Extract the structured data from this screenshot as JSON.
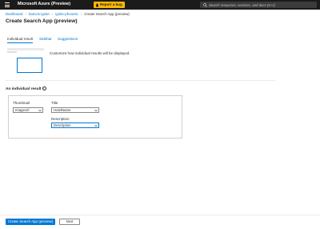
{
  "header": {
    "brand": "Microsoft Azure (Preview)",
    "report_bug": "Report a bug",
    "search_placeholder": "Search resources, services, and docs (G+/)"
  },
  "breadcrumb": {
    "items": [
      "Dashboard",
      "bamcis-ignite",
      "ignite-phonetic"
    ],
    "current": "Create Search App (preview)"
  },
  "page": {
    "title": "Create Search App (preview)"
  },
  "tabs": [
    {
      "label": "Individual result",
      "active": true
    },
    {
      "label": "Sidebar",
      "active": false
    },
    {
      "label": "Suggestions",
      "active": false
    }
  ],
  "intro": {
    "description": "Customize how individual results will be displayed."
  },
  "result_section": {
    "heading": "An individual result",
    "info_glyph": "i"
  },
  "form": {
    "thumbnail": {
      "label": "Thumbnail",
      "value": "ImageUrl"
    },
    "title": {
      "label": "Title",
      "value": "HotelName"
    },
    "description": {
      "label": "Description",
      "value": "Description"
    }
  },
  "footer": {
    "primary_label": "Create Search App (preview)",
    "secondary_label": "Next"
  },
  "colors": {
    "topbar": "#1b1b1b",
    "accent": "#0078d4",
    "bug_badge": "#ffb900"
  }
}
